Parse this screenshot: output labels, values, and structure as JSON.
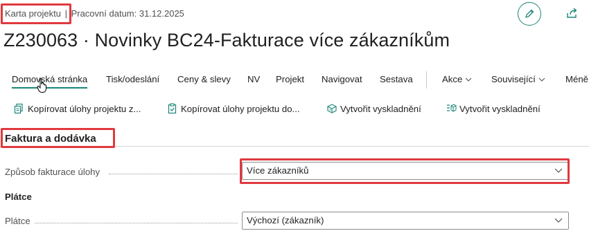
{
  "breadcrumb": {
    "page_name": "Karta projektu",
    "separator": "|",
    "work_date": "Pracovní datum: 31.12.2025"
  },
  "header": {
    "title": "Z230063 · Novinky BC24-Fakturace více zákazníkům"
  },
  "menu": {
    "items": [
      "Domovská stránka",
      "Tisk/odeslání",
      "Ceny & slevy",
      "NV",
      "Projekt",
      "Navigovat",
      "Sestava",
      "Akce",
      "Související",
      "Méně"
    ]
  },
  "actions": {
    "items": [
      "Kopírovat úlohy projektu z...",
      "Kopírovat úlohy projektu do...",
      "Vytvořit vyskladnění",
      "Vytvořit vyskladnění"
    ]
  },
  "section": {
    "title": "Faktura a dodávka"
  },
  "fields": {
    "billing_method_label": "Způsob fakturace úlohy",
    "billing_method_value": "Více zákazníků",
    "payer_group_heading": "Plátce",
    "payer_label": "Plátce",
    "payer_value": "Výchozí (zákazník)"
  },
  "colors": {
    "accent": "#1a8577",
    "highlight": "#e0393e"
  }
}
